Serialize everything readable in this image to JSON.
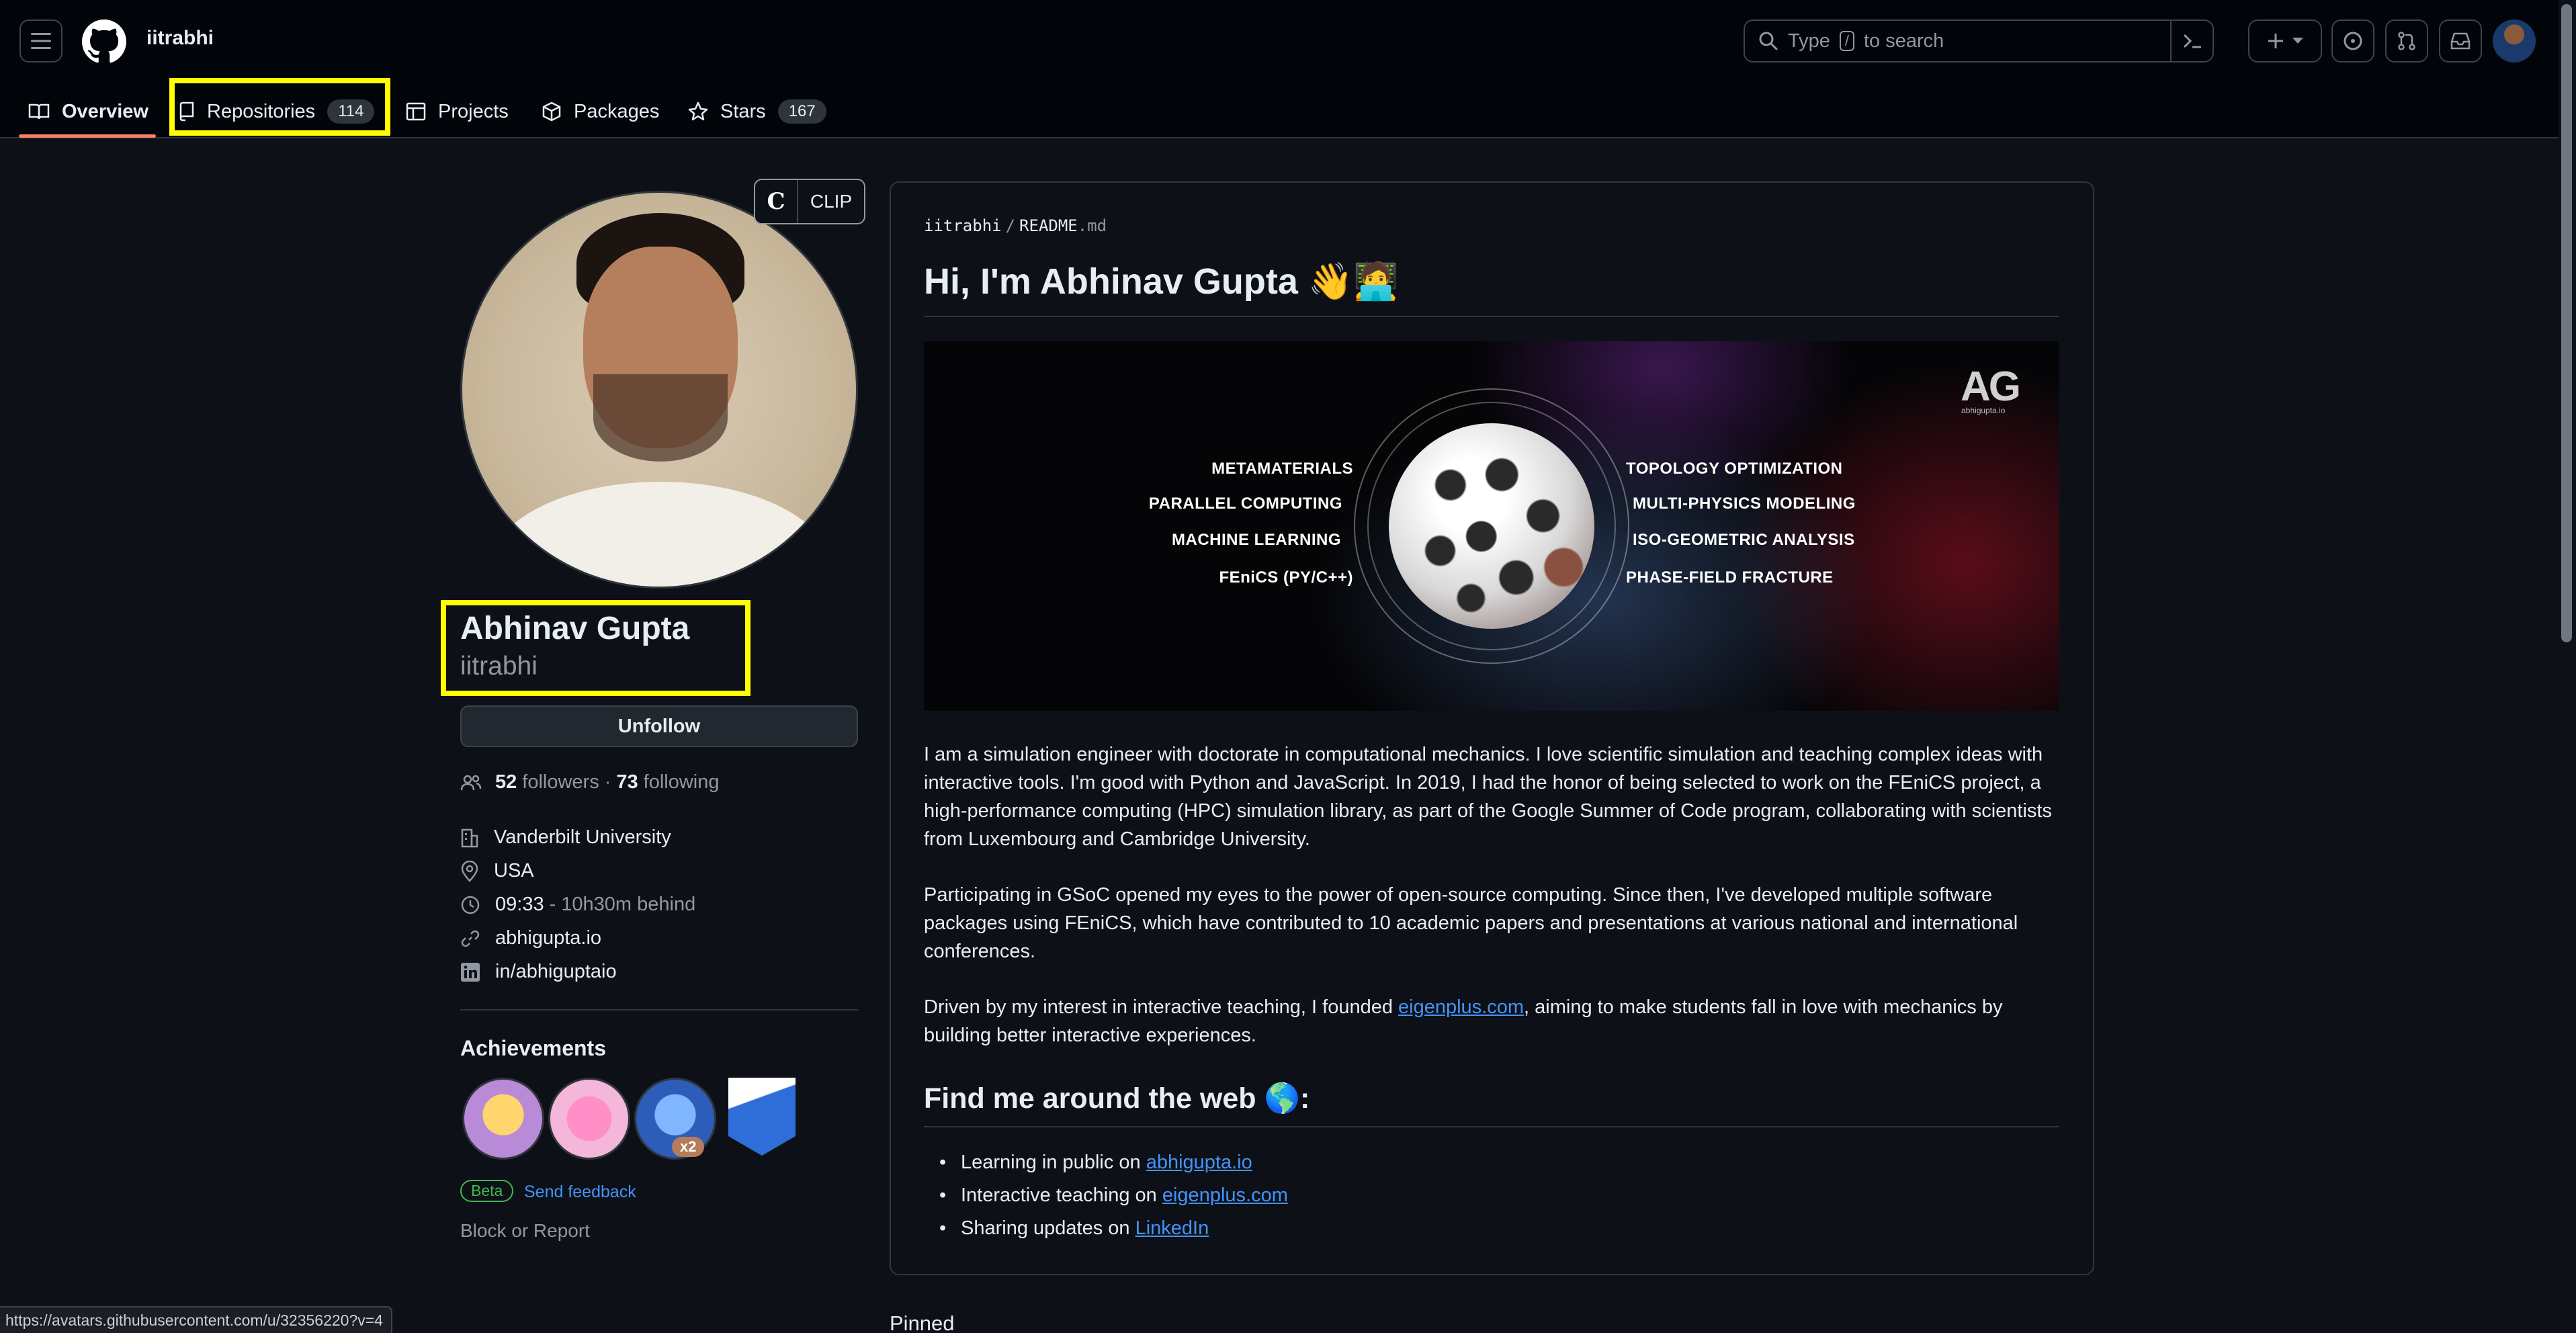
{
  "header": {
    "username": "iitrabhi",
    "search_placeholder_pre": "Type",
    "search_key": "/",
    "search_placeholder_post": "to search"
  },
  "tabs": [
    {
      "label": "Overview"
    },
    {
      "label": "Repositories",
      "count": "114"
    },
    {
      "label": "Projects"
    },
    {
      "label": "Packages"
    },
    {
      "label": "Stars",
      "count": "167"
    }
  ],
  "profile": {
    "clip_label": "CLIP",
    "clip_logo": "C",
    "name": "Abhinav Gupta",
    "login": "iitrabhi",
    "unfollow_label": "Unfollow",
    "followers_count": "52",
    "followers_label": "followers",
    "separator": "·",
    "following_count": "73",
    "following_label": "following",
    "organization": "Vanderbilt University",
    "location": "USA",
    "time": "09:33",
    "time_note": "- 10h30m behind",
    "website": "abhigupta.io",
    "linkedin": "in/abhiguptaio",
    "achievements_title": "Achievements",
    "achievement_badge_count": "x2",
    "beta_label": "Beta",
    "feedback_label": "Send feedback",
    "block_label": "Block or Report"
  },
  "readme": {
    "path_owner": "iitrabhi",
    "path_sep": "/",
    "path_file": "README",
    "path_ext": ".md",
    "heading": "Hi, I'm Abhinav Gupta 👋🧑‍💻",
    "banner": {
      "logo": "AG",
      "logo_sub": "abhigupta.io",
      "left_topics": [
        "METAMATERIALS",
        "PARALLEL COMPUTING",
        "MACHINE LEARNING",
        "FEniCS (PY/C++)"
      ],
      "right_topics": [
        "TOPOLOGY OPTIMIZATION",
        "MULTI-PHYSICS MODELING",
        "ISO-GEOMETRIC ANALYSIS",
        "PHASE-FIELD FRACTURE"
      ]
    },
    "p1": "I am a simulation engineer with doctorate in computational mechanics. I love scientific simulation and teaching complex ideas with interactive tools. I'm good with Python and JavaScript. In 2019, I had the honor of being selected to work on the FEniCS project, a high-performance computing (HPC) simulation library, as part of the Google Summer of Code program, collaborating with scientists from Luxembourg and Cambridge University.",
    "p2": "Participating in GSoC opened my eyes to the power of open-source computing. Since then, I've developed multiple software packages using FEniCS, which have contributed to 10 academic papers and presentations at various national and international conferences.",
    "p3_pre": "Driven by my interest in interactive teaching, I founded ",
    "p3_link": "eigenplus.com",
    "p3_post": ", aiming to make students fall in love with mechanics by building better interactive experiences.",
    "h2": "Find me around the web 🌎:",
    "links": [
      {
        "pre": "Learning in public on ",
        "link": "abhigupta.io"
      },
      {
        "pre": "Interactive teaching on ",
        "link": "eigenplus.com"
      },
      {
        "pre": "Sharing updates on ",
        "link": "LinkedIn"
      }
    ]
  },
  "pinned_label": "Pinned",
  "status_url": "https://avatars.githubusercontent.com/u/32356220?v=4"
}
